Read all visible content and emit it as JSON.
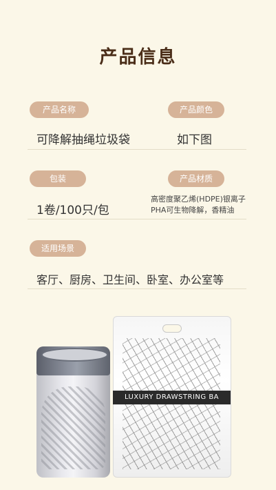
{
  "title": "产品信息",
  "fields": {
    "name_label": "产品名称",
    "name_value": "可降解抽绳垃圾袋",
    "color_label": "产品颜色",
    "color_value": "如下图",
    "package_label": "包装",
    "package_value": "1卷/100只/包",
    "material_label": "产品材质",
    "material_line1": "高密度聚乙烯(HDPE)银离子",
    "material_line2": "PHA可生物降解，香精油",
    "scene_label": "适用场景",
    "scene_value": "客厅、厨房、卫生间、卧室、办公室等"
  },
  "product": {
    "bag_band_text": "LUXURY DRAWSTRING BA"
  },
  "colors": {
    "background": "#fbf7e8",
    "title": "#4a2d18",
    "pill": "#d6b398"
  }
}
